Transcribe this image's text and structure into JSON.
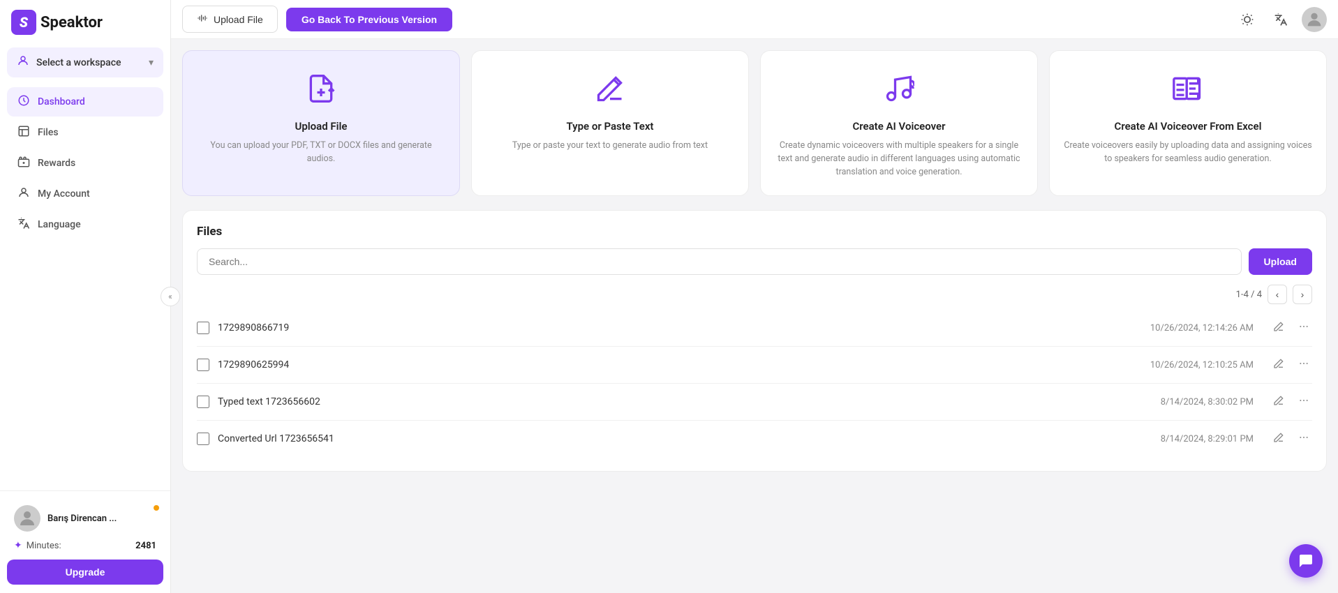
{
  "app": {
    "name": "Speaktor"
  },
  "sidebar": {
    "workspace_label": "Select a workspace",
    "nav_items": [
      {
        "id": "dashboard",
        "label": "Dashboard",
        "active": true
      },
      {
        "id": "files",
        "label": "Files",
        "active": false
      },
      {
        "id": "rewards",
        "label": "Rewards",
        "active": false
      },
      {
        "id": "my-account",
        "label": "My Account",
        "active": false
      },
      {
        "id": "language",
        "label": "Language",
        "active": false
      }
    ],
    "user": {
      "name": "Barış Direncan ...",
      "minutes_label": "Minutes:",
      "minutes_count": "2481"
    },
    "upgrade_label": "Upgrade",
    "collapse_icon": "«"
  },
  "topbar": {
    "upload_file_label": "Upload File",
    "go_back_label": "Go Back To Previous Version"
  },
  "cards": [
    {
      "id": "upload-file",
      "title": "Upload File",
      "description": "You can upload your PDF, TXT or DOCX files and generate audios."
    },
    {
      "id": "type-paste",
      "title": "Type or Paste Text",
      "description": "Type or paste your text to generate audio from text"
    },
    {
      "id": "ai-voiceover",
      "title": "Create AI Voiceover",
      "description": "Create dynamic voiceovers with multiple speakers for a single text and generate audio in different languages using automatic translation and voice generation."
    },
    {
      "id": "ai-voiceover-excel",
      "title": "Create AI Voiceover From Excel",
      "description": "Create voiceovers easily by uploading data and assigning voices to speakers for seamless audio generation."
    }
  ],
  "files_section": {
    "title": "Files",
    "search_placeholder": "Search...",
    "upload_label": "Upload",
    "pagination": "1-4 / 4",
    "files": [
      {
        "id": 1,
        "name": "1729890866719",
        "date": "10/26/2024, 12:14:26 AM"
      },
      {
        "id": 2,
        "name": "1729890625994",
        "date": "10/26/2024, 12:10:25 AM"
      },
      {
        "id": 3,
        "name": "Typed text 1723656602",
        "date": "8/14/2024, 8:30:02 PM"
      },
      {
        "id": 4,
        "name": "Converted Url 1723656541",
        "date": "8/14/2024, 8:29:01 PM"
      }
    ]
  }
}
